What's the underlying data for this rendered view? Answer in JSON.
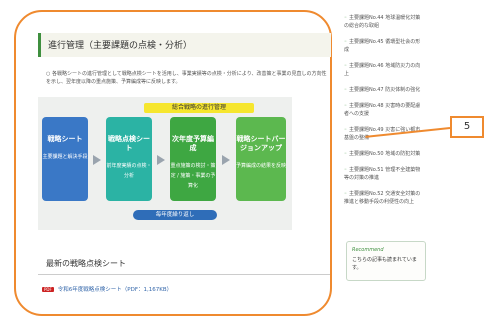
{
  "header": {
    "title": "進行管理（主要課題の点検・分析）"
  },
  "intro": "○ 各戦略シートの進行管理として戦略点検シートを活用し、事業実績等の点検・分析により、改善策と事業の見直しの方向性を示し、翌年度以降の重点施策、予算編成等に反映します。",
  "diagram": {
    "title": "総合戦略の進行管理",
    "boxes": [
      {
        "title": "戦略シート",
        "sub": "主要課題と解決手段"
      },
      {
        "title": "戦略点検シート",
        "sub": "前年度実績の点検・分析"
      },
      {
        "title": "次年度予算編成",
        "sub": "重点施策の検討・策定 / 施策・事業の予算化"
      },
      {
        "title": "戦略シートバージョンアップ",
        "sub": "予算編成の結果を反映"
      }
    ],
    "loop_label": "毎年度繰り返し"
  },
  "section2": {
    "title": "最新の戦略点検シート"
  },
  "pdf": {
    "tag": "PDF",
    "label": "令和6年度戦略点検シート（PDF：1,167KB）"
  },
  "sidebar": {
    "items": [
      "主要課題No.44 地球温暖化対策の総合的な取組",
      "主要課題No.45 循環型社会の形成",
      "主要課題No.46 地域防災力の向上",
      "主要課題No.47 防災体制の強化",
      "主要課題No.48 災害時の要配慮者への支援",
      "主要課題No.49 災害に強い都市基盤の整備",
      "主要課題No.50 地域の防犯対策",
      "主要課題No.51 管理不全建築物等の対策の推進",
      "主要課題No.52 交通安全対策の推進と移動手段の利便性の向上"
    ]
  },
  "recommend": {
    "label": "Recommend",
    "text": "こちらの記事も読まれています。"
  },
  "callout": {
    "number": "5"
  },
  "colors": {
    "accent": "#ef8a2f",
    "green": "#3f8f3f"
  }
}
